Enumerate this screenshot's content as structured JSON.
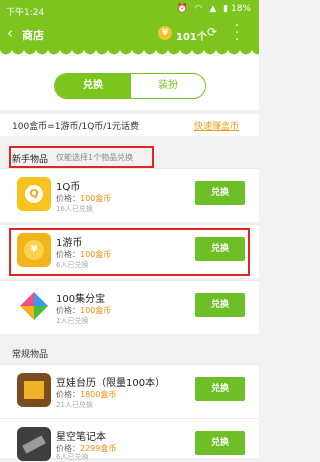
{
  "status_bar": {
    "time": "下午1:24",
    "battery": "18%"
  },
  "header": {
    "title": "商店",
    "coins": "101个",
    "coin_glyph": "¥",
    "colors": {
      "primary": "#7cc51f",
      "accent": "#f08c14",
      "highlight": "#e02424"
    }
  },
  "tabs": [
    {
      "label": "兑换",
      "active": true
    },
    {
      "label": "装扮",
      "active": false
    }
  ],
  "exchange_info": {
    "rate": "100盒币=1游币/1Q币/1元话费",
    "earn_link": "快速赚盒币"
  },
  "section_new": {
    "label": "新手物品",
    "hint": "仅能选择1个物品兑换"
  },
  "new_items": [
    {
      "name": "1Q币",
      "price_label": "价格：",
      "price": "100盒币",
      "sold": "16人已兑换",
      "button": "兑换",
      "icon": "qq-coin-icon",
      "glyph": "Q"
    },
    {
      "name": "1游币",
      "price_label": "价格：",
      "price": "100盒币",
      "sold": "6人已兑换",
      "button": "兑换",
      "icon": "game-coin-icon",
      "glyph": "¥"
    },
    {
      "name": "100集分宝",
      "price_label": "价格：",
      "price": "100盒币",
      "sold": "1人已兑换",
      "button": "兑换",
      "icon": "jifenbao-icon"
    }
  ],
  "section_regular": {
    "label": "常规物品"
  },
  "regular_items": [
    {
      "name": "豆娃台历（限量100本）",
      "price_label": "价格：",
      "price": "1800盒币",
      "sold": "21人已兑换",
      "button": "兑换"
    },
    {
      "name": "星空笔记本",
      "price_label": "价格：",
      "price": "2299盒币",
      "sold": "6人已兑换",
      "button": "兑换"
    }
  ]
}
